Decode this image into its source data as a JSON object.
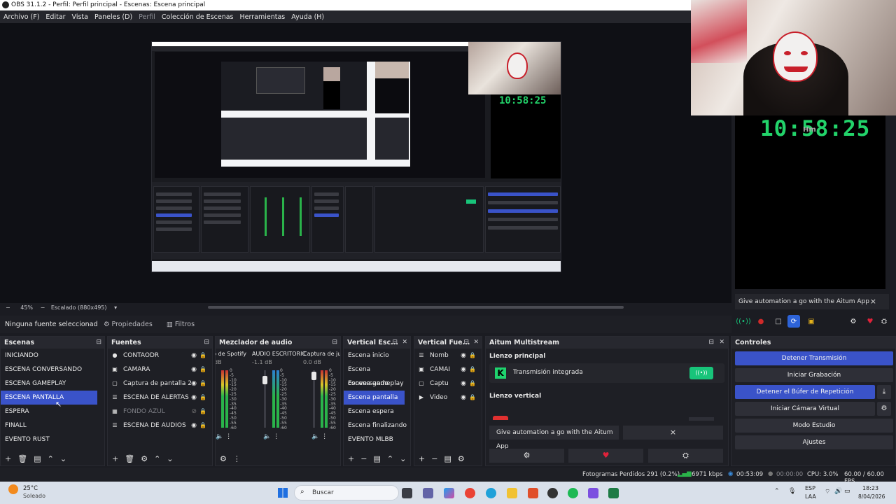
{
  "window": {
    "title": "OBS 31.1.2 - Perfil: Perfil principal - Escenas: Escena principal"
  },
  "menu": [
    {
      "label": "Archivo (F)"
    },
    {
      "label": "Editar"
    },
    {
      "label": "Vista"
    },
    {
      "label": "Paneles (D)"
    },
    {
      "label": "Perfil",
      "dim": true
    },
    {
      "label": "Colección de Escenas"
    },
    {
      "label": "Herramientas"
    },
    {
      "label": "Ayuda (H)"
    }
  ],
  "preview": {
    "clock": "10:58:25",
    "clock_overlay_text": "Hm",
    "zoom_pct": "45%",
    "scale_label": "Escalado (880x495)"
  },
  "overlay": {
    "aitum_text": "Give automation a go with the Aitum App",
    "close": "×"
  },
  "propbar": {
    "no_source": "Ninguna fuente seleccionad",
    "properties": "Propiedades",
    "filters": "Filtros"
  },
  "scenes": {
    "title": "Escenas",
    "items": [
      "INICIANDO",
      "ESCENA CONVERSANDO",
      "ESCENA GAMEPLAY",
      "ESCENA PANTALLA",
      "ESPERA",
      "FINALL",
      "EVENTO RUST"
    ],
    "selected": 3
  },
  "sources": {
    "title": "Fuentes",
    "items": [
      {
        "label": "CONTAODR",
        "icon": "●",
        "visible": true
      },
      {
        "label": "CAMARA",
        "icon": "▣",
        "visible": true
      },
      {
        "label": "Captura de pantalla 2",
        "icon": "▢",
        "visible": true
      },
      {
        "label": "ESCENA DE ALERTAS",
        "icon": "☰",
        "visible": true
      },
      {
        "label": "FONDO AZUL",
        "icon": "▦",
        "visible": false
      },
      {
        "label": "ESCENA DE AUDIOS",
        "icon": "☰",
        "visible": true
      }
    ]
  },
  "mixer": {
    "title": "Mezclador de audio",
    "channels": [
      {
        "name": "io de Spotify",
        "db": "dB"
      },
      {
        "name": "AUDIO ESCRITORIC",
        "db": "-1.1 dB"
      },
      {
        "name": "Captura de jueg",
        "db": "0.0 dB"
      }
    ],
    "scale": [
      "0",
      "-5",
      "-10",
      "-15",
      "-20",
      "-25",
      "-30",
      "-35",
      "-40",
      "-45",
      "-50",
      "-55",
      "-60"
    ]
  },
  "vertical_scenes": {
    "title": "Vertical Esc...",
    "items": [
      "Escena inicio",
      "Escena conversando",
      "Escena gameplay",
      "Escena pantalla",
      "Escena espera",
      "Escena finalizando",
      "EVENTO MLBB"
    ],
    "selected": 3
  },
  "vertical_sources": {
    "title": "Vertical Fue...",
    "items": [
      {
        "label": "Nomb",
        "icon": "☰"
      },
      {
        "label": "CAMAI",
        "icon": "▣"
      },
      {
        "label": "Captu",
        "icon": "▢"
      },
      {
        "label": "Video",
        "icon": "▶"
      }
    ]
  },
  "aitum": {
    "title": "Aitum Multistream",
    "main_canvas": "Lienzo principal",
    "integrated": "Transmisión integrada",
    "vertical_canvas": "Lienzo vertical",
    "banner": "Give automation a go with the Aitum App",
    "close": "×"
  },
  "controls": {
    "title": "Controles",
    "stop_stream": "Detener Transmisión",
    "start_recording": "Iniciar Grabación",
    "stop_replay": "Detener el Búfer de Repetición",
    "start_vcam": "Iniciar Cámara Virtual",
    "studio_mode": "Modo Estudio",
    "settings": "Ajustes"
  },
  "status": {
    "dropped": "Fotogramas Perdidos 291 (0.2%)",
    "bitrate": "6971 kbps",
    "stream_time": "00:53:09",
    "rec_time": "00:00:00",
    "cpu": "CPU: 3.0%",
    "fps": "60.00 / 60.00 FPS"
  },
  "taskbar": {
    "temp": "25°C",
    "weather": "Soleado",
    "search": "Buscar",
    "lang": "ESP",
    "lang2": "LAA",
    "time": "18:23",
    "date": "8/04/2026"
  },
  "colors": {
    "accent": "#3a53c9",
    "clock": "#22d36a",
    "bg": "#1b1c22"
  }
}
